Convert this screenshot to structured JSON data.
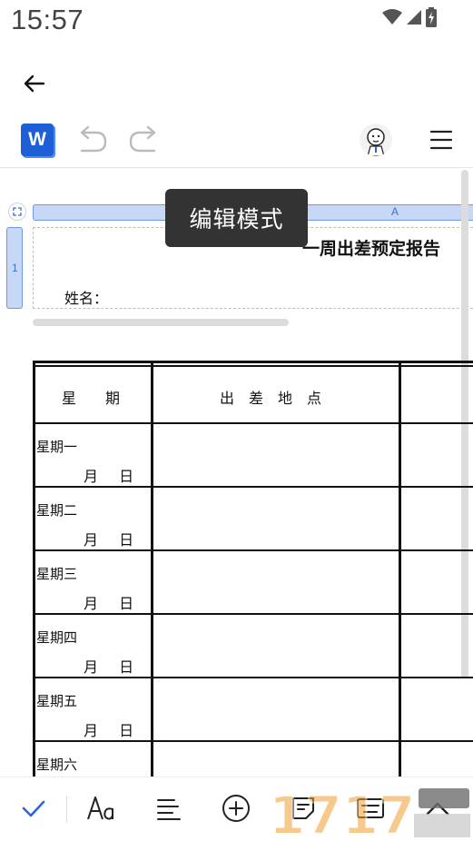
{
  "status": {
    "time": "15:57"
  },
  "toolbar": {
    "app_icon_letter": "W"
  },
  "tooltip": {
    "text": "编辑模式"
  },
  "ruler": {
    "column_label": "A",
    "row_label": "1"
  },
  "document": {
    "title": "一周出差预定报告",
    "name_label": "姓名：",
    "table": {
      "headers": [
        "星　　期",
        "出　差　地　点"
      ],
      "rows": [
        {
          "day": "星期一",
          "date": "月 日"
        },
        {
          "day": "星期二",
          "date": "月 日"
        },
        {
          "day": "星期三",
          "date": "月 日"
        },
        {
          "day": "星期四",
          "date": "月 日"
        },
        {
          "day": "星期五",
          "date": "月 日"
        },
        {
          "day": "星期六",
          "date": ""
        }
      ]
    }
  },
  "colors": {
    "accent": "#1e5fd8",
    "ruler_fill": "#c6d8f6",
    "tooltip_bg": "#333333"
  },
  "icons": {
    "status": [
      "wifi-icon",
      "signal-icon",
      "battery-icon"
    ],
    "bottom": [
      "check-icon",
      "font-icon",
      "align-icon",
      "add-icon",
      "note-icon",
      "keyboard-icon",
      "chevron-up-icon"
    ]
  }
}
